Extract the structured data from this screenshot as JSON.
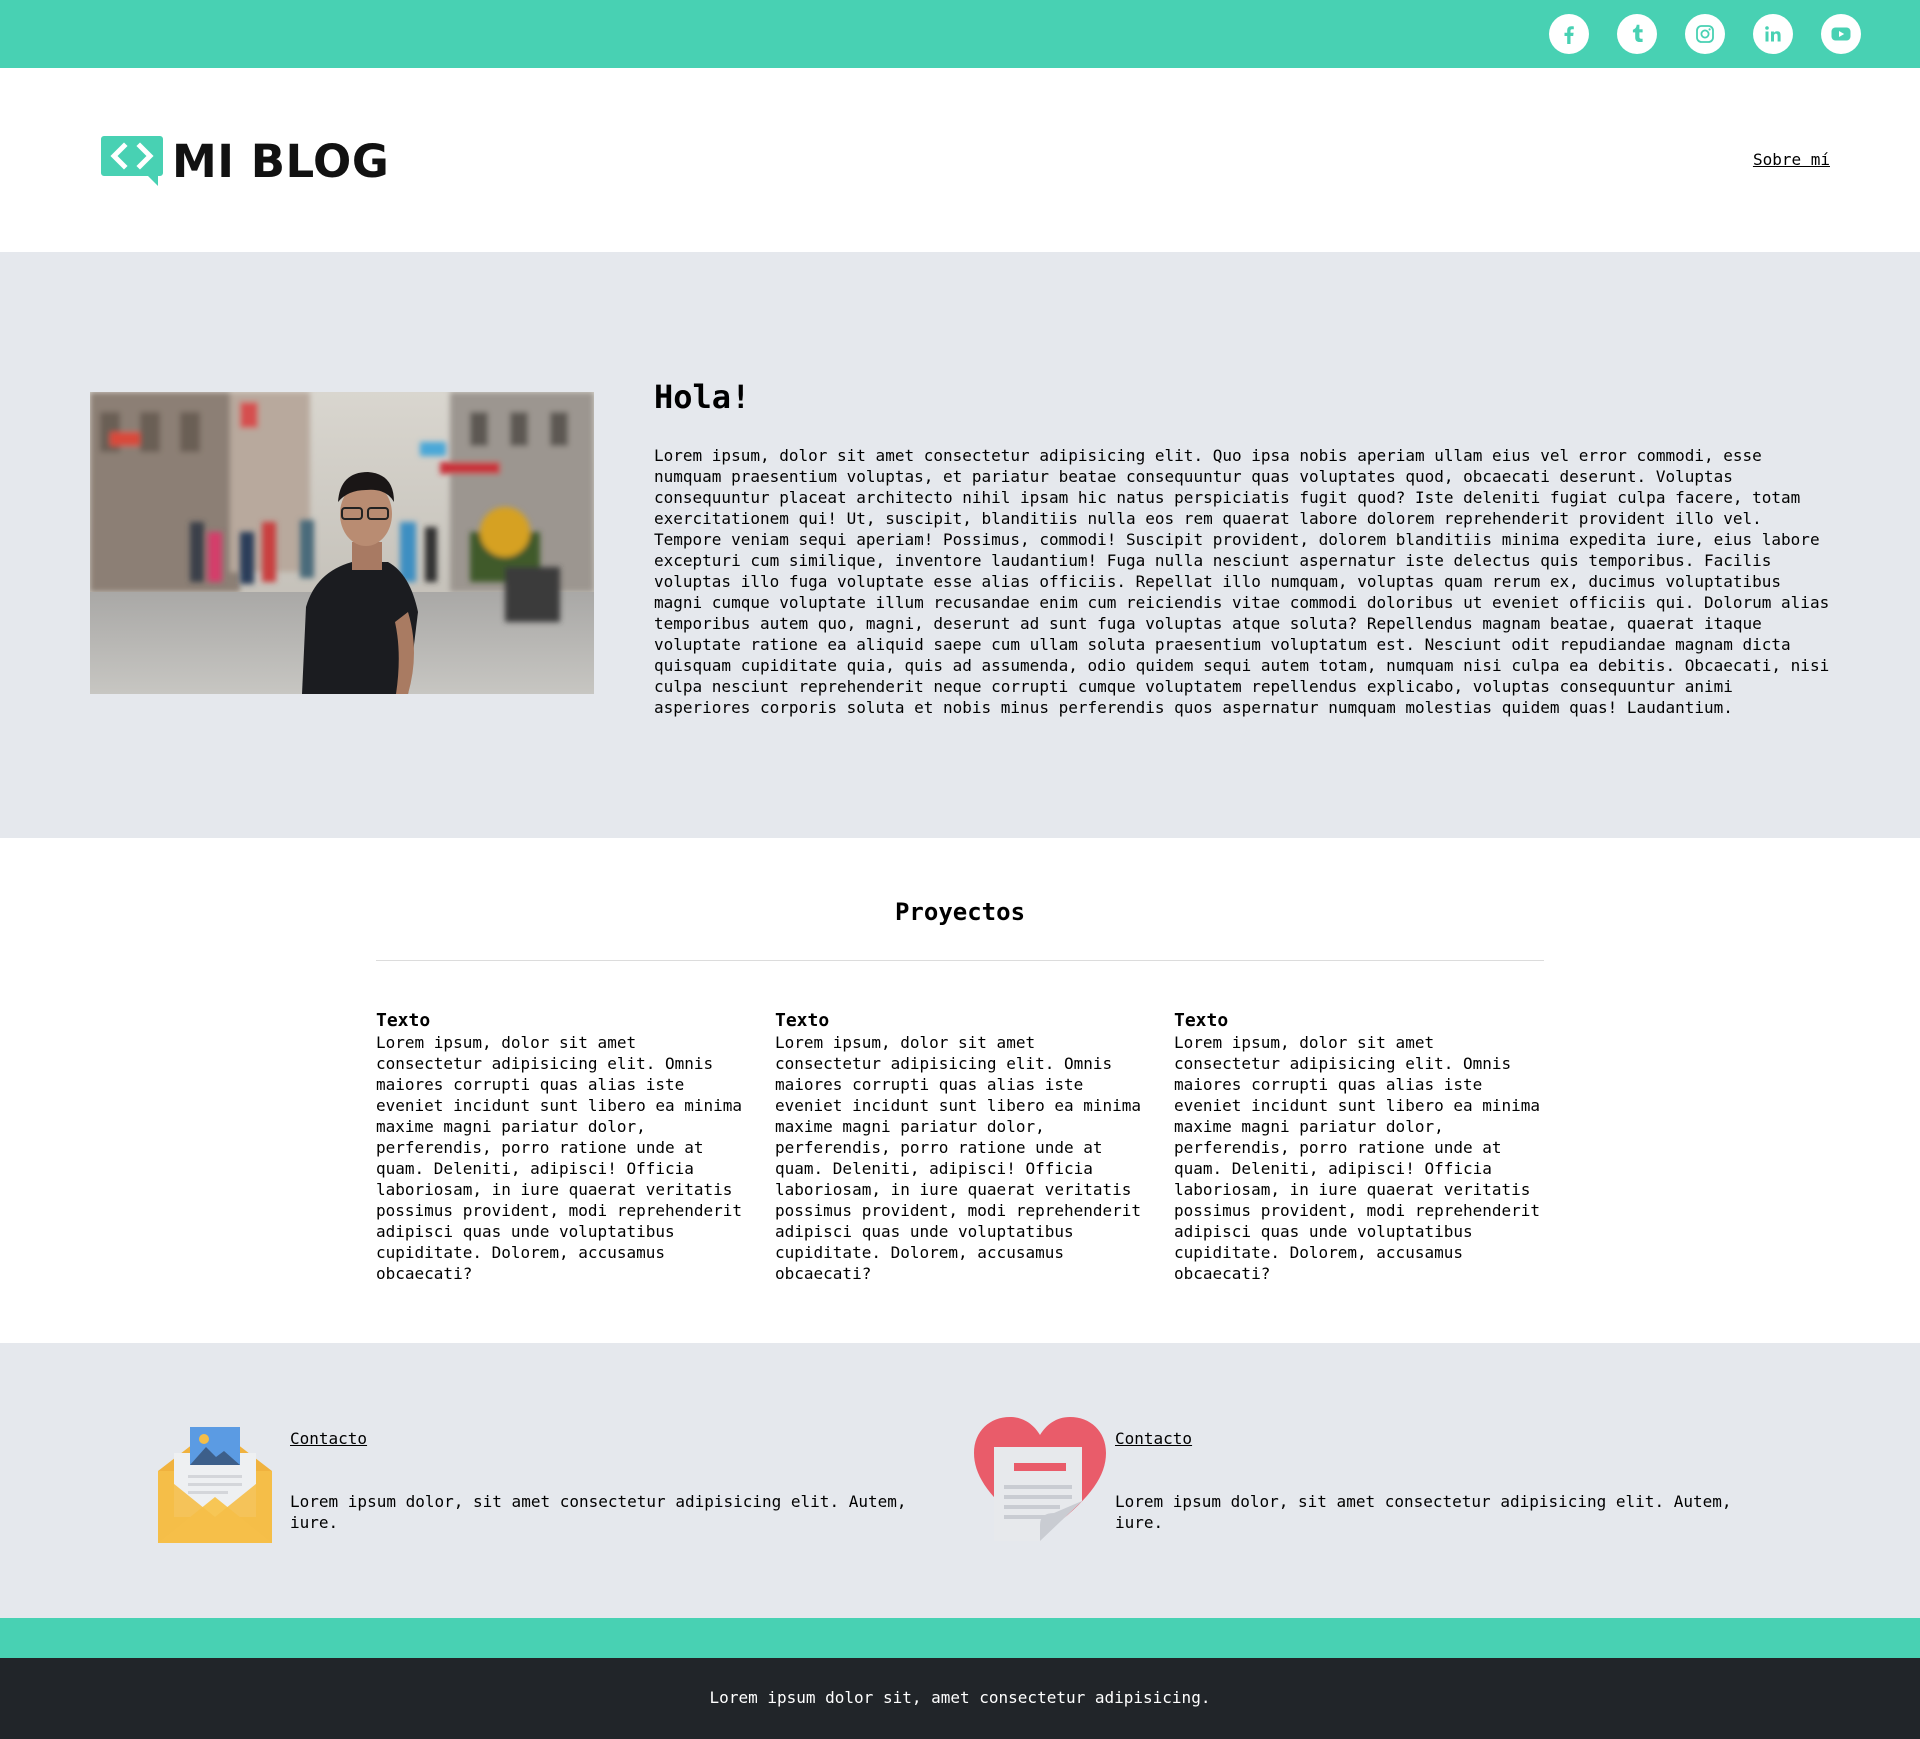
{
  "colors": {
    "accent": "#48d1b3",
    "light_bg": "#e5e8ed",
    "footer_bg": "#212529"
  },
  "social": [
    {
      "name": "facebook-icon"
    },
    {
      "name": "tumblr-icon"
    },
    {
      "name": "instagram-icon"
    },
    {
      "name": "linkedin-icon"
    },
    {
      "name": "youtube-icon"
    }
  ],
  "header": {
    "logo_text": "MI BLOG",
    "nav_link": "Sobre mí"
  },
  "hero": {
    "title": "Hola!",
    "text": "Lorem ipsum, dolor sit amet consectetur adipisicing elit. Quo ipsa nobis aperiam ullam eius vel error commodi, esse numquam praesentium voluptas, et pariatur beatae consequuntur quas voluptates quod, obcaecati deserunt. Voluptas consequuntur placeat architecto nihil ipsam hic natus perspiciatis fugit quod? Iste deleniti fugiat culpa facere, totam exercitationem qui! Ut, suscipit, blanditiis nulla eos rem quaerat labore dolorem reprehenderit provident illo vel. Tempore veniam sequi aperiam! Possimus, commodi! Suscipit provident, dolorem blanditiis minima expedita iure, eius labore excepturi cum similique, inventore laudantium! Fuga nulla nesciunt aspernatur iste delectus quis temporibus. Facilis voluptas illo fuga voluptate esse alias officiis. Repellat illo numquam, voluptas quam rerum ex, ducimus voluptatibus magni cumque voluptate illum recusandae enim cum reiciendis vitae commodi doloribus ut eveniet officiis qui. Dolorum alias temporibus autem quo, magni, deserunt ad sunt fuga voluptas atque soluta? Repellendus magnam beatae, quaerat itaque voluptate ratione ea aliquid saepe cum ullam soluta praesentium voluptatum est. Nesciunt odit repudiandae magnam dicta quisquam cupiditate quia, quis ad assumenda, odio quidem sequi autem totam, numquam nisi culpa ea debitis. Obcaecati, nisi culpa nesciunt reprehenderit neque corrupti cumque voluptatem repellendus explicabo, voluptas consequuntur animi asperiores corporis soluta et nobis minus perferendis quos aspernatur numquam molestias quidem quas! Laudantium."
  },
  "projects": {
    "title": "Proyectos",
    "items": [
      {
        "title": "Texto",
        "text": "Lorem ipsum, dolor sit amet consectetur adipisicing elit. Omnis maiores corrupti quas alias iste eveniet incidunt sunt libero ea minima maxime magni pariatur dolor, perferendis, porro ratione unde at quam. Deleniti, adipisci! Officia laboriosam, in iure quaerat veritatis possimus provident, modi reprehenderit adipisci quas unde voluptatibus cupiditate. Dolorem, accusamus obcaecati?"
      },
      {
        "title": "Texto",
        "text": "Lorem ipsum, dolor sit amet consectetur adipisicing elit. Omnis maiores corrupti quas alias iste eveniet incidunt sunt libero ea minima maxime magni pariatur dolor, perferendis, porro ratione unde at quam. Deleniti, adipisci! Officia laboriosam, in iure quaerat veritatis possimus provident, modi reprehenderit adipisci quas unde voluptatibus cupiditate. Dolorem, accusamus obcaecati?"
      },
      {
        "title": "Texto",
        "text": "Lorem ipsum, dolor sit amet consectetur adipisicing elit. Omnis maiores corrupti quas alias iste eveniet incidunt sunt libero ea minima maxime magni pariatur dolor, perferendis, porro ratione unde at quam. Deleniti, adipisci! Officia laboriosam, in iure quaerat veritatis possimus provident, modi reprehenderit adipisci quas unde voluptatibus cupiditate. Dolorem, accusamus obcaecati?"
      }
    ]
  },
  "contact": {
    "items": [
      {
        "icon": "envelope-icon",
        "link": "Contacto",
        "text": "Lorem ipsum dolor, sit amet consectetur adipisicing elit. Autem, iure."
      },
      {
        "icon": "heart-letter-icon",
        "link": "Contacto",
        "text": "Lorem ipsum dolor, sit amet consectetur adipisicing elit. Autem, iure."
      }
    ]
  },
  "footer": {
    "text": "Lorem ipsum dolor sit, amet consectetur adipisicing."
  }
}
